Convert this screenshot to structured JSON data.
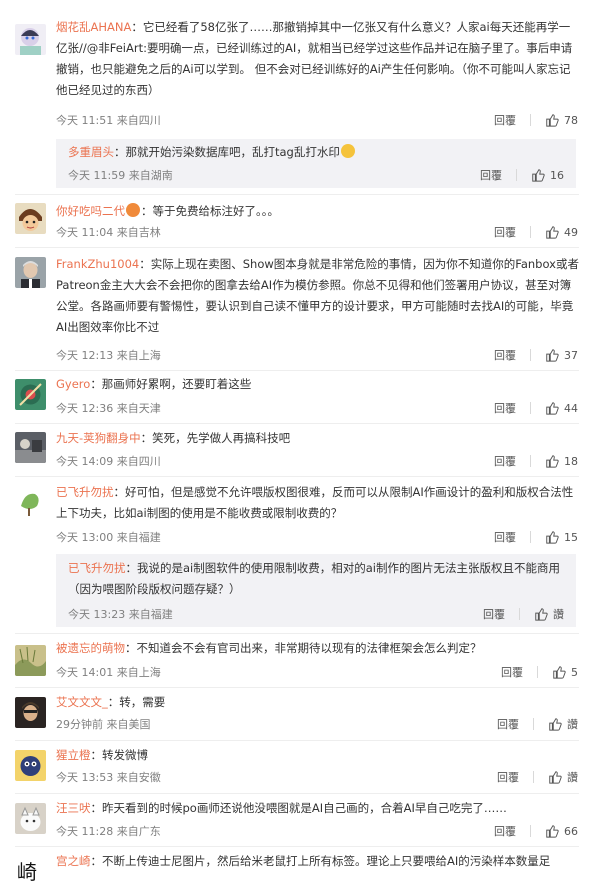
{
  "comments": [
    {
      "user": "烟花乱AHANA",
      "text": "：它已经看了58亿张了……那撤销掉其中一亿张又有什么意义？人家ai每天还能再学一亿张//@非FeiArt:要明确一点，已经训练过的AI，就相当已经学过这些作品并记在脑子里了。事后申请撤销，也只能避免之后的Ai可以学到。 但不会对已经训练好的Ai产生任何影响。（你不可能叫人家忘记他已经见过的东西）",
      "meta": "今天 11:51 来自四川",
      "reply_label": "回覆",
      "likes": "78",
      "reply": {
        "user": "多重眉头",
        "text": "：那就开始污染数据库吧，乱打tag乱打水印",
        "meta": "今天 11:59 来自湖南",
        "reply_label": "回覆",
        "likes": "16"
      }
    },
    {
      "user": "你好吃吗二代",
      "text": "：等于免费给标注好了。。。",
      "meta": "今天 11:04 来自吉林",
      "reply_label": "回覆",
      "likes": "49"
    },
    {
      "user": "FrankZhu1004",
      "text": "：实际上现在卖图、Show图本身就是非常危险的事情，因为你不知道你的Fanbox或者Patreon金主大大会不会把你的图拿去给AI作为模仿参照。你总不见得和他们签署用户协议，甚至对簿公堂。各路画师要有警惕性，要认识到自己读不懂甲方的设计要求，甲方可能随时去找AI的可能，毕竟AI出图效率你比不过",
      "meta": "今天 12:13 来自上海",
      "reply_label": "回覆",
      "likes": "37"
    },
    {
      "user": "Gyero",
      "text": "：那画师好累啊，还要盯着这些",
      "meta": "今天 12:36 来自天津",
      "reply_label": "回覆",
      "likes": "44"
    },
    {
      "user": "九天-荚狗翻身中",
      "text": "：笑死，先学做人再搞科技吧",
      "meta": "今天 14:09 来自四川",
      "reply_label": "回覆",
      "likes": "18"
    },
    {
      "user": "已飞升勿扰",
      "text": "：好可怕，但是感觉不允许喂版权图很难，反而可以从限制AI作画设计的盈利和版权合法性上下功夫，比如ai制图的使用是不能收费或限制收费的？",
      "meta": "今天 13:00 来自福建",
      "reply_label": "回覆",
      "likes": "15",
      "reply": {
        "user": "已飞升勿扰",
        "text": "：我说的是ai制图软件的使用限制收费，相对的ai制作的图片无法主张版权且不能商用（因为喂图阶段版权问题存疑？）",
        "meta": "今天 13:23 来自福建",
        "reply_label": "回覆",
        "likes": "讚"
      }
    },
    {
      "user": "被遗忘的萌物",
      "text": "：不知道会不会有官司出来，非常期待以现有的法律框架会怎么判定？",
      "meta": "今天 14:01 来自上海",
      "reply_label": "回覆",
      "likes": "5"
    },
    {
      "user": "艾文文文_",
      "text": "：转，需要",
      "meta": "29分钟前 来自美国",
      "reply_label": "回覆",
      "likes": "讚"
    },
    {
      "user": "猩立橙",
      "text": "：转发微博",
      "meta": "今天 13:53 来自安徽",
      "reply_label": "回覆",
      "likes": "讚"
    },
    {
      "user": "汪三吠",
      "text": "：昨天看到的时候po画师还说他没喂图就是AI自己画的，合着AI早自己吃完了……",
      "meta": "今天 11:28 来自广东",
      "reply_label": "回覆",
      "likes": "66"
    },
    {
      "user": "宫之崎",
      "text": "：不断上传迪士尼图片，然后给米老鼠打上所有标签。理论上只要喂给AI的污染样本数量足",
      "meta": "",
      "reply_label": "",
      "likes": ""
    }
  ],
  "icons": {
    "like": "thumbs-up-icon",
    "emoji_laugh": "laughing-emoji-icon",
    "emoji_fire": "fire-emoji-icon"
  },
  "colors": {
    "username": "#eb7350",
    "meta": "#808080",
    "reply_bg": "#f2f2f5"
  }
}
